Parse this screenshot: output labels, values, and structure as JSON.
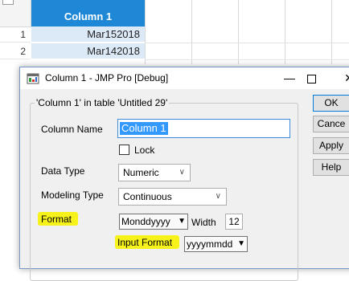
{
  "table": {
    "column_header": "Column 1",
    "rows": [
      {
        "num": "1",
        "value": "Mar152018"
      },
      {
        "num": "2",
        "value": "Mar142018"
      }
    ]
  },
  "dialog": {
    "title": "Column 1 - JMP Pro [Debug]",
    "group_label": "'Column 1' in table 'Untitled 29'",
    "column_name_label": "Column Name",
    "column_name_value": "Column 1",
    "lock_label": "Lock",
    "lock_checked": false,
    "data_type_label": "Data Type",
    "data_type_value": "Numeric",
    "modeling_type_label": "Modeling Type",
    "modeling_type_value": "Continuous",
    "format_label": "Format",
    "format_value": "Monddyyyy",
    "width_label": "Width",
    "width_value": "12",
    "input_format_label": "Input Format",
    "input_format_value": "yyyymmdd",
    "buttons": {
      "ok": "OK",
      "cancel": "Cance",
      "apply": "Apply",
      "help": "Help"
    }
  },
  "colors": {
    "header_blue": "#1e88d6",
    "selected_cell": "#dce9f7",
    "highlight_yellow": "#f7f31a",
    "focus_border": "#3c8bd8"
  },
  "icons": [
    "jmp-app-icon",
    "minimize-icon",
    "maximize-icon",
    "close-icon",
    "chevron-down-icon",
    "dropdown-arrow-icon"
  ]
}
